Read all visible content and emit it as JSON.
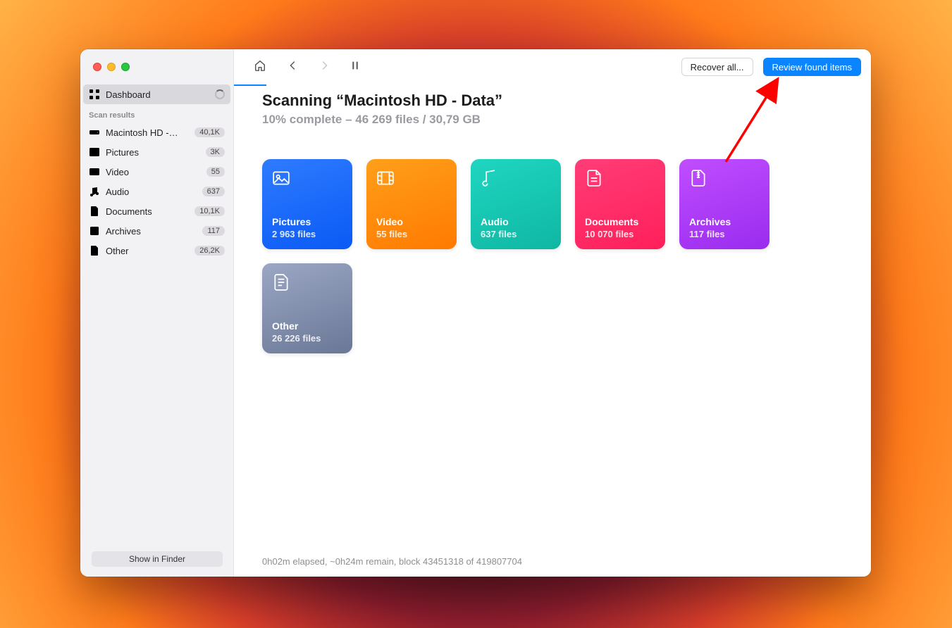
{
  "sidebar": {
    "dashboard_label": "Dashboard",
    "section_title": "Scan results",
    "items": [
      {
        "label": "Macintosh HD -…",
        "badge": "40,1K",
        "icon": "drive"
      },
      {
        "label": "Pictures",
        "badge": "3K",
        "icon": "picture"
      },
      {
        "label": "Video",
        "badge": "55",
        "icon": "video"
      },
      {
        "label": "Audio",
        "badge": "637",
        "icon": "audio"
      },
      {
        "label": "Documents",
        "badge": "10,1K",
        "icon": "document"
      },
      {
        "label": "Archives",
        "badge": "117",
        "icon": "archive"
      },
      {
        "label": "Other",
        "badge": "26,2K",
        "icon": "other"
      }
    ],
    "footer_button": "Show in Finder"
  },
  "toolbar": {
    "recover_label": "Recover all...",
    "review_label": "Review found items"
  },
  "scan": {
    "title": "Scanning “Macintosh HD - Data”",
    "subtitle": "10% complete – 46 269 files / 30,79 GB"
  },
  "cards": [
    {
      "key": "pictures",
      "title": "Pictures",
      "sub": "2 963 files",
      "class": "c-pictures"
    },
    {
      "key": "video",
      "title": "Video",
      "sub": "55 files",
      "class": "c-video"
    },
    {
      "key": "audio",
      "title": "Audio",
      "sub": "637 files",
      "class": "c-audio"
    },
    {
      "key": "documents",
      "title": "Documents",
      "sub": "10 070 files",
      "class": "c-documents"
    },
    {
      "key": "archives",
      "title": "Archives",
      "sub": "117 files",
      "class": "c-archives"
    },
    {
      "key": "other",
      "title": "Other",
      "sub": "26 226 files",
      "class": "c-other"
    }
  ],
  "status": "0h02m elapsed, ~0h24m remain, block 43451318 of 419807704"
}
